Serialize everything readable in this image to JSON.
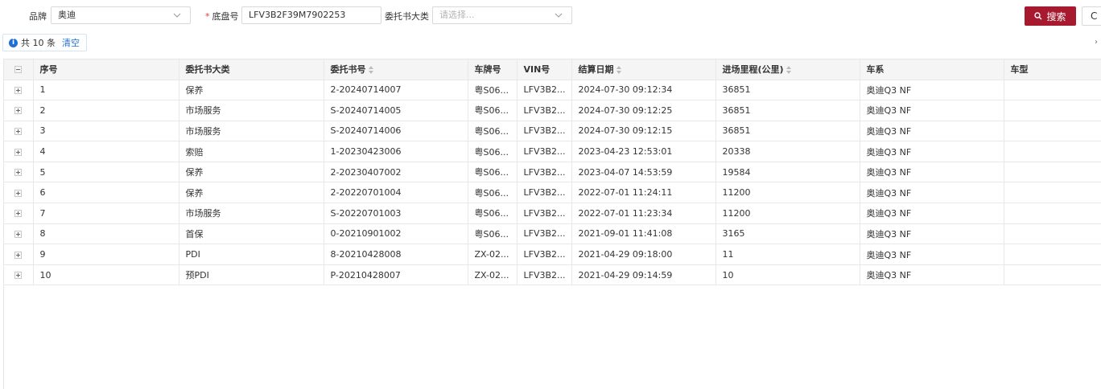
{
  "search": {
    "brand_label": "品牌",
    "brand_value": "奥迪",
    "chassis_required_mark": "*",
    "chassis_label": "底盘号",
    "chassis_value": "LFV3B2F39M7902253",
    "category_label": "委托书大类",
    "category_placeholder": "请选择...",
    "search_button": "搜索",
    "reset_button": "C"
  },
  "summary": {
    "total_text": "共 10 条",
    "clear_link": "清空"
  },
  "table": {
    "columns": [
      "序号",
      "委托书大类",
      "委托书号",
      "车牌号",
      "VIN号",
      "结算日期",
      "进场里程(公里)",
      "车系",
      "车型"
    ],
    "rows": [
      {
        "no": "1",
        "category": "保养",
        "order": "2-20240714007",
        "plate": "粤S06...",
        "vin": "LFV3B2...",
        "date": "2024-07-30 09:12:34",
        "mileage": "36851",
        "series": "奥迪Q3 NF",
        "model": ""
      },
      {
        "no": "2",
        "category": "市场服务",
        "order": "S-20240714005",
        "plate": "粤S06...",
        "vin": "LFV3B2...",
        "date": "2024-07-30 09:12:25",
        "mileage": "36851",
        "series": "奥迪Q3 NF",
        "model": ""
      },
      {
        "no": "3",
        "category": "市场服务",
        "order": "S-20240714006",
        "plate": "粤S06...",
        "vin": "LFV3B2...",
        "date": "2024-07-30 09:12:15",
        "mileage": "36851",
        "series": "奥迪Q3 NF",
        "model": ""
      },
      {
        "no": "4",
        "category": "索赔",
        "order": "1-20230423006",
        "plate": "粤S06...",
        "vin": "LFV3B2...",
        "date": "2023-04-23 12:53:01",
        "mileage": "20338",
        "series": "奥迪Q3 NF",
        "model": ""
      },
      {
        "no": "5",
        "category": "保养",
        "order": "2-20230407002",
        "plate": "粤S06...",
        "vin": "LFV3B2...",
        "date": "2023-04-07 14:53:59",
        "mileage": "19584",
        "series": "奥迪Q3 NF",
        "model": ""
      },
      {
        "no": "6",
        "category": "保养",
        "order": "2-20220701004",
        "plate": "粤S06...",
        "vin": "LFV3B2...",
        "date": "2022-07-01 11:24:11",
        "mileage": "11200",
        "series": "奥迪Q3 NF",
        "model": ""
      },
      {
        "no": "7",
        "category": "市场服务",
        "order": "S-20220701003",
        "plate": "粤S06...",
        "vin": "LFV3B2...",
        "date": "2022-07-01 11:23:34",
        "mileage": "11200",
        "series": "奥迪Q3 NF",
        "model": ""
      },
      {
        "no": "8",
        "category": "首保",
        "order": "0-20210901002",
        "plate": "粤S06...",
        "vin": "LFV3B2...",
        "date": "2021-09-01 11:41:08",
        "mileage": "3165",
        "series": "奥迪Q3 NF",
        "model": ""
      },
      {
        "no": "9",
        "category": "PDI",
        "order": "8-20210428008",
        "plate": "ZX-02...",
        "vin": "LFV3B2...",
        "date": "2021-04-29 09:18:00",
        "mileage": "11",
        "series": "奥迪Q3 NF",
        "model": ""
      },
      {
        "no": "10",
        "category": "预PDI",
        "order": "P-20210428007",
        "plate": "ZX-02...",
        "vin": "LFV3B2...",
        "date": "2021-04-29 09:14:59",
        "mileage": "10",
        "series": "奥迪Q3 NF",
        "model": ""
      }
    ]
  },
  "colors": {
    "primary": "#a6192e",
    "link": "#1f6fd6"
  }
}
